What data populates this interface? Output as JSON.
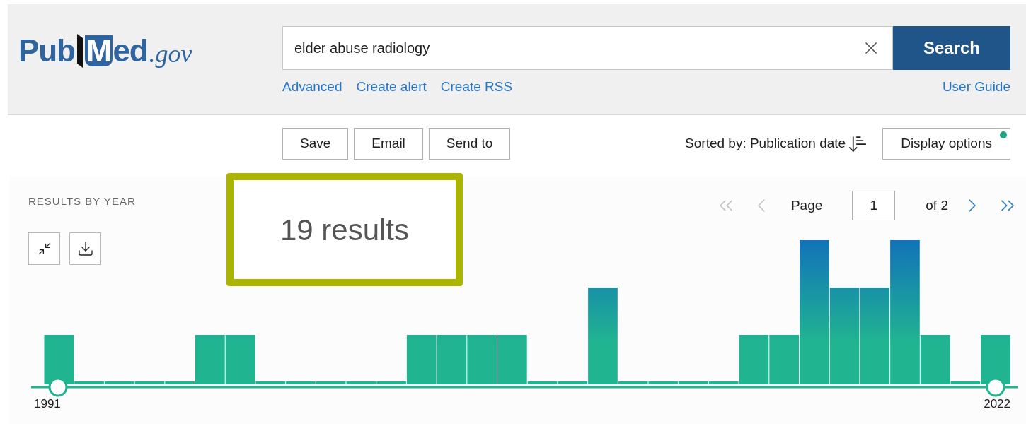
{
  "logo": {
    "parts": [
      "Pub",
      "Med",
      ".gov"
    ]
  },
  "search": {
    "value": "elder abuse radiology",
    "button": "Search",
    "links": [
      "Advanced",
      "Create alert",
      "Create RSS"
    ],
    "user_guide": "User Guide"
  },
  "actions": [
    "Save",
    "Email",
    "Send to"
  ],
  "sort": {
    "label": "Sorted by: Publication date"
  },
  "display_options": {
    "label": "Display options",
    "indicator": true
  },
  "results_by_year": {
    "title": "RESULTS BY YEAR",
    "start_year": "1991",
    "end_year": "2022"
  },
  "results_count": "19 results",
  "pagination": {
    "page_label": "Page",
    "page": "1",
    "of": "of 2",
    "nav": [
      {
        "kind": "first",
        "disabled": true
      },
      {
        "kind": "prev",
        "disabled": true
      },
      {
        "kind": "next",
        "disabled": false
      },
      {
        "kind": "last",
        "disabled": false
      }
    ]
  }
}
